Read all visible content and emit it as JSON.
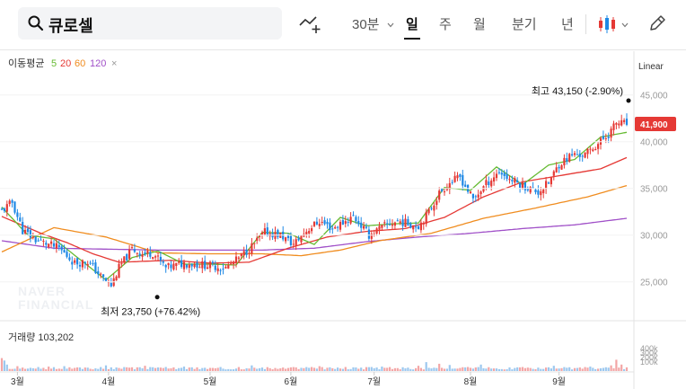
{
  "stock_name": "큐로셀",
  "toolbar": {
    "interval": "30분",
    "day": "일",
    "week": "주",
    "month": "월",
    "quarter": "분기",
    "year": "년"
  },
  "ma": {
    "label": "이동평균",
    "p5": "5",
    "p20": "20",
    "p60": "60",
    "p120": "120",
    "close": "×"
  },
  "scale_label": "Linear",
  "watermark": [
    "NAVER",
    "FINANCIAL"
  ],
  "colors": {
    "up": "#e53935",
    "down": "#1e88e5",
    "ma5": "#66bb33",
    "ma20": "#e53935",
    "ma60": "#f08c1e",
    "ma120": "#a050c8"
  },
  "chart_data": {
    "type": "candlestick",
    "y_ticks": [
      "45,000",
      "40,000",
      "35,000",
      "30,000",
      "25,000"
    ],
    "y_tick_values": [
      45000,
      40000,
      35000,
      30000,
      25000
    ],
    "ylim": [
      21800,
      46800
    ],
    "x_labels": [
      "3월",
      "4월",
      "5월",
      "6월",
      "7월",
      "8월",
      "9월"
    ],
    "x_label_index": [
      6,
      41,
      80,
      111,
      143,
      180,
      214
    ],
    "current_price": "41,900",
    "current_value": 41900,
    "high_label": "최고 43,150 (-2.90%)",
    "high_value": 43150,
    "low_label": "최저 23,750 (+76.42%)",
    "low_value": 23750,
    "volume_label": "거래량 103,202",
    "volume_ticks": [
      "400k",
      "300k",
      "200k",
      "100k"
    ],
    "ma_anchors": {
      "ma5": [
        [
          0,
          33000
        ],
        [
          10,
          30000
        ],
        [
          20,
          29600
        ],
        [
          30,
          27400
        ],
        [
          40,
          25200
        ],
        [
          50,
          27600
        ],
        [
          60,
          28300
        ],
        [
          70,
          26900
        ],
        [
          80,
          26900
        ],
        [
          90,
          26800
        ],
        [
          100,
          30300
        ],
        [
          110,
          30200
        ],
        [
          120,
          29000
        ],
        [
          130,
          31900
        ],
        [
          140,
          31000
        ],
        [
          150,
          31200
        ],
        [
          160,
          31300
        ],
        [
          170,
          35100
        ],
        [
          180,
          34800
        ],
        [
          190,
          37300
        ],
        [
          200,
          35400
        ],
        [
          210,
          37500
        ],
        [
          220,
          38100
        ],
        [
          230,
          40500
        ],
        [
          240,
          41000
        ]
      ],
      "ma20": [
        [
          0,
          32000
        ],
        [
          15,
          30200
        ],
        [
          25,
          29200
        ],
        [
          35,
          28000
        ],
        [
          45,
          27100
        ],
        [
          55,
          27200
        ],
        [
          65,
          27300
        ],
        [
          80,
          27000
        ],
        [
          95,
          27100
        ],
        [
          110,
          28600
        ],
        [
          125,
          29800
        ],
        [
          140,
          30400
        ],
        [
          155,
          30700
        ],
        [
          170,
          31900
        ],
        [
          185,
          34100
        ],
        [
          200,
          35700
        ],
        [
          215,
          36400
        ],
        [
          230,
          37100
        ],
        [
          240,
          38300
        ]
      ],
      "ma60": [
        [
          0,
          28200
        ],
        [
          20,
          30800
        ],
        [
          40,
          29800
        ],
        [
          60,
          28100
        ],
        [
          80,
          28000
        ],
        [
          100,
          28000
        ],
        [
          115,
          27800
        ],
        [
          130,
          28400
        ],
        [
          145,
          29400
        ],
        [
          165,
          30200
        ],
        [
          185,
          31800
        ],
        [
          205,
          32900
        ],
        [
          225,
          34100
        ],
        [
          240,
          35300
        ]
      ],
      "ma120": [
        [
          0,
          29400
        ],
        [
          20,
          28600
        ],
        [
          40,
          28500
        ],
        [
          60,
          28400
        ],
        [
          80,
          28400
        ],
        [
          100,
          28400
        ],
        [
          120,
          28600
        ],
        [
          140,
          29300
        ],
        [
          160,
          29800
        ],
        [
          180,
          30200
        ],
        [
          200,
          30700
        ],
        [
          220,
          31100
        ],
        [
          240,
          31800
        ]
      ]
    },
    "price_anchors": [
      [
        0,
        32600
      ],
      [
        4,
        33500
      ],
      [
        8,
        30500
      ],
      [
        13,
        29500
      ],
      [
        18,
        29000
      ],
      [
        22,
        28600
      ],
      [
        28,
        27000
      ],
      [
        33,
        27200
      ],
      [
        38,
        25600
      ],
      [
        42,
        24600
      ],
      [
        45,
        26500
      ],
      [
        50,
        28500
      ],
      [
        54,
        28000
      ],
      [
        58,
        28100
      ],
      [
        63,
        26500
      ],
      [
        70,
        27000
      ],
      [
        78,
        26800
      ],
      [
        86,
        26500
      ],
      [
        91,
        27500
      ],
      [
        96,
        28800
      ],
      [
        101,
        30300
      ],
      [
        107,
        30000
      ],
      [
        112,
        29000
      ],
      [
        117,
        30500
      ],
      [
        122,
        31500
      ],
      [
        127,
        30700
      ],
      [
        135,
        32000
      ],
      [
        141,
        30000
      ],
      [
        147,
        31000
      ],
      [
        152,
        31500
      ],
      [
        160,
        31000
      ],
      [
        164,
        32500
      ],
      [
        168,
        34500
      ],
      [
        172,
        35600
      ],
      [
        176,
        36200
      ],
      [
        181,
        33800
      ],
      [
        186,
        35500
      ],
      [
        191,
        36800
      ],
      [
        195,
        36000
      ],
      [
        201,
        35200
      ],
      [
        206,
        34600
      ],
      [
        210,
        35600
      ],
      [
        214,
        37600
      ],
      [
        219,
        38600
      ],
      [
        224,
        38600
      ],
      [
        229,
        39800
      ],
      [
        233,
        40800
      ],
      [
        236,
        42000
      ],
      [
        240,
        41900
      ]
    ],
    "volume_spikes": [
      [
        0,
        3.2
      ],
      [
        1,
        2.6
      ],
      [
        2,
        1.6
      ],
      [
        6,
        1.2
      ],
      [
        18,
        1.1
      ],
      [
        24,
        1.2
      ],
      [
        40,
        1.4
      ],
      [
        55,
        1.3
      ],
      [
        70,
        1.1
      ],
      [
        96,
        1.4
      ],
      [
        122,
        1.2
      ],
      [
        146,
        1.1
      ],
      [
        160,
        1.3
      ],
      [
        163,
        2.2
      ],
      [
        168,
        1.8
      ],
      [
        172,
        1.5
      ],
      [
        184,
        1.6
      ],
      [
        212,
        1.3
      ],
      [
        226,
        1.1
      ],
      [
        234,
        1.4
      ],
      [
        236,
        2.8
      ],
      [
        238,
        1.6
      ]
    ]
  }
}
